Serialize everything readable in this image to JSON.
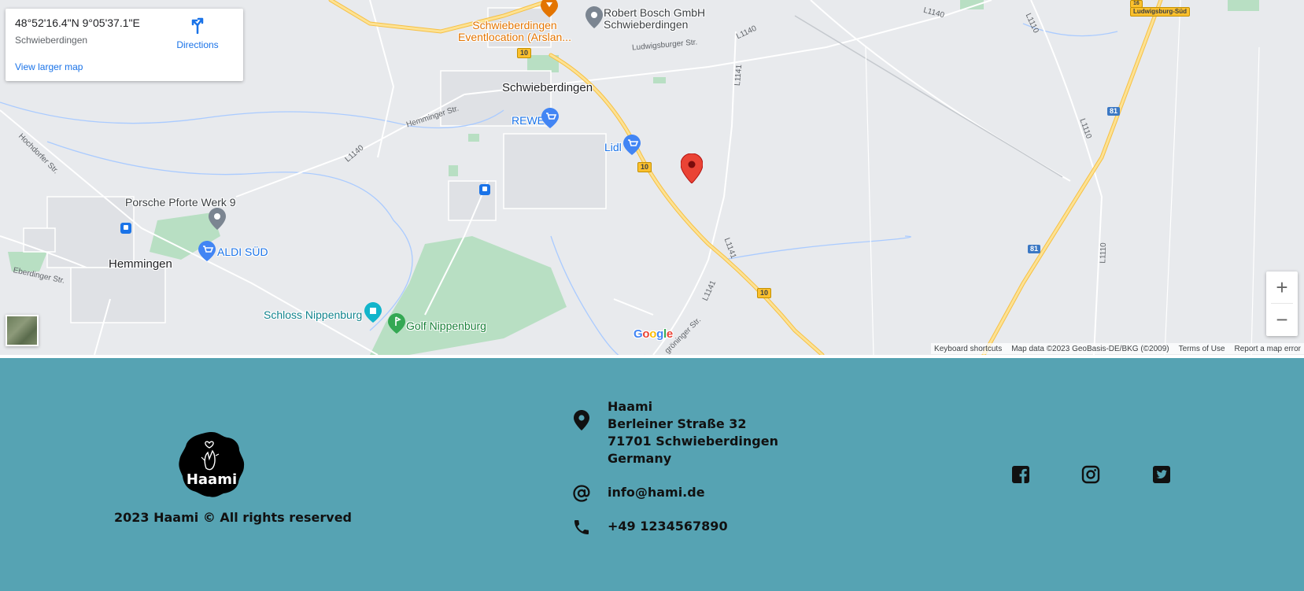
{
  "map": {
    "info_card": {
      "coordinates": "48°52'16.4\"N 9°05'37.1\"E",
      "place": "Schwieberdingen",
      "directions_label": "Directions",
      "view_larger_label": "View larger map"
    },
    "labels": {
      "schwieberdingen": "Schwieberdingen",
      "hemmingen": "Hemmingen",
      "rewe": "REWE",
      "lidl": "Lidl",
      "aldi": "ALDI SÜD",
      "porsche": "Porsche Pforte Werk 9",
      "bosch_1": "Robert Bosch GmbH",
      "bosch_2": "Schwieberdingen",
      "event_1": "Schwieberdingen",
      "event_2": "Eventlocation (Arslan...",
      "schloss": "Schloss Nippenburg",
      "golf": "Golf Nippenburg",
      "ludwigsburger_str": "Ludwigsburger Str.",
      "hemminger_str": "Hemminger Str.",
      "hochdorfer_str": "Hochdorfer Str.",
      "eberdinger_str": "Eberdinger Str.",
      "groninger_str": "gröninger Str.",
      "l1140_a": "L1140",
      "l1140_b": "L1140",
      "l1140_c": "L1140",
      "l1141_a": "L1141",
      "l1141_b": "L1141",
      "l1141_c": "L1141",
      "l1110_a": "L1110",
      "l1110_b": "L1110",
      "l1110_c": "L1110",
      "shield_10_a": "10",
      "shield_10_b": "10",
      "shield_10_c": "10",
      "shield_81_a": "81",
      "shield_81_b": "81",
      "shield_16": "16",
      "ludwigsburg_sued": "Ludwigsburg-Süd"
    },
    "zoom_in": "+",
    "zoom_out": "−",
    "google": [
      "G",
      "o",
      "o",
      "g",
      "l",
      "e"
    ],
    "google_colors": [
      "#4285f4",
      "#ea4335",
      "#fbbc05",
      "#4285f4",
      "#34a853",
      "#ea4335"
    ],
    "footer": {
      "shortcuts": "Keyboard shortcuts",
      "map_data": "Map data ©2023 GeoBasis-DE/BKG (©2009)",
      "terms": "Terms of Use",
      "report": "Report a map error"
    },
    "icons": {
      "pin": "location-pin-icon",
      "directions": "directions-icon",
      "cart": "shopping-cart-icon",
      "transit": "transit-icon",
      "landmark": "landmark-icon",
      "golf": "golf-icon"
    }
  },
  "footer": {
    "logo_text": "Haami",
    "copyright": "2023 Haami © All rights reserved",
    "address": {
      "name": "Haami",
      "street": "Berleiner Straße 32",
      "city": "71701 Schwieberdingen",
      "country": "Germany"
    },
    "email": "info@hami.de",
    "phone": "+49 1234567890",
    "social": [
      "facebook-icon",
      "instagram-icon",
      "twitter-icon"
    ],
    "background_color": "#56a3b3"
  }
}
